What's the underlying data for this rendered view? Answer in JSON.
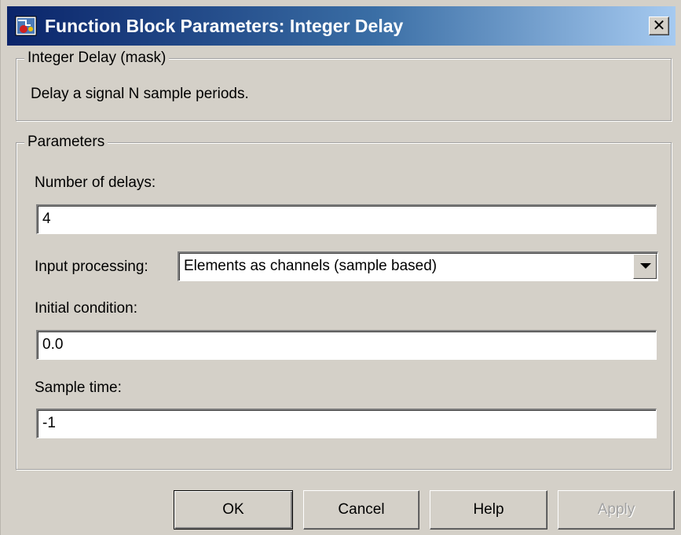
{
  "window": {
    "title": "Function Block Parameters: Integer Delay",
    "icon": "simulink-block-icon",
    "close_symbol": "✕"
  },
  "mask_group": {
    "legend": "Integer Delay (mask)",
    "description": "Delay a signal N sample periods."
  },
  "params_group": {
    "legend": "Parameters",
    "fields": {
      "num_delays": {
        "label": "Number of delays:",
        "value": "4"
      },
      "input_processing": {
        "label": "Input processing:",
        "value": "Elements as channels (sample based)"
      },
      "initial_condition": {
        "label": "Initial condition:",
        "value": "0.0"
      },
      "sample_time": {
        "label": "Sample time:",
        "value": "-1"
      }
    }
  },
  "buttons": {
    "ok": "OK",
    "cancel": "Cancel",
    "help": "Help",
    "apply": "Apply"
  },
  "colors": {
    "title_gradient_start": "#0a246a",
    "title_gradient_end": "#a6caf0",
    "dialog_face": "#d4d0c8"
  }
}
